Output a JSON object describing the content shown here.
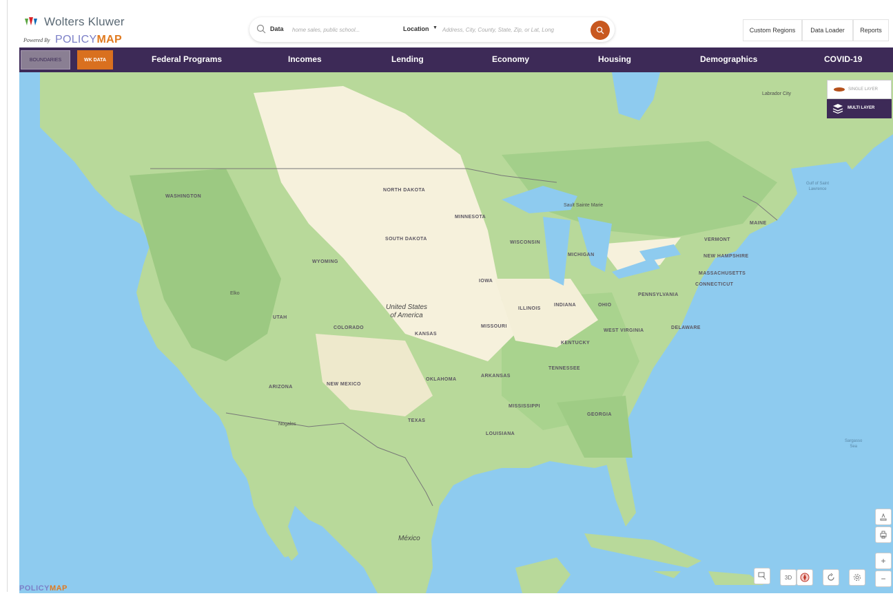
{
  "header": {
    "brand": "Wolters Kluwer",
    "powered_by": "Powered By",
    "product_prefix": "POLICY",
    "product_suffix": "MAP",
    "search": {
      "data_label": "Data",
      "data_placeholder": "home sales, public school...",
      "location_label": "Location",
      "location_placeholder": "Address, City, County, State, Zip, or Lat, Long"
    },
    "buttons": [
      "Custom Regions",
      "Data Loader",
      "Reports"
    ]
  },
  "nav": {
    "boundaries": "BOUNDARIES",
    "wk_data": "WK DATA",
    "items": [
      "Federal Programs",
      "Incomes",
      "Lending",
      "Economy",
      "Housing",
      "Demographics",
      "COVID-19"
    ]
  },
  "layers": {
    "single": "SINGLE LAYER",
    "multi": "MULTI LAYER"
  },
  "map": {
    "states": [
      "WASHINGTON",
      "NORTH DAKOTA",
      "MINNESOTA",
      "SOUTH DAKOTA",
      "WISCONSIN",
      "WYOMING",
      "MICHIGAN",
      "IOWA",
      "UTAH",
      "COLORADO",
      "KANSAS",
      "ILLINOIS",
      "INDIANA",
      "OHIO",
      "MISSOURI",
      "KENTUCKY",
      "WEST VIRGINIA",
      "PENNSYLVANIA",
      "TENNESSEE",
      "ARIZONA",
      "NEW MEXICO",
      "OKLAHOMA",
      "ARKANSAS",
      "MISSISSIPPI",
      "GEORGIA",
      "TEXAS",
      "LOUISIANA",
      "MAINE",
      "VERMONT",
      "NEW HAMPSHIRE",
      "MASSACHUSETTS",
      "CONNECTICUT",
      "DELAWARE"
    ],
    "cities": [
      "Elko",
      "Nogales",
      "Sault Sainte Marie",
      "Labrador City"
    ],
    "countries": [
      "United States",
      "of America",
      "México"
    ],
    "water": [
      "Gulf of Saint",
      "Lawrence",
      "Sargasso",
      "Sea"
    ],
    "controls": {
      "three_d": "3D",
      "zoom_in": "+",
      "zoom_out": "−"
    },
    "footer_brand_a": "POLICY",
    "footer_brand_b": "MAP"
  }
}
